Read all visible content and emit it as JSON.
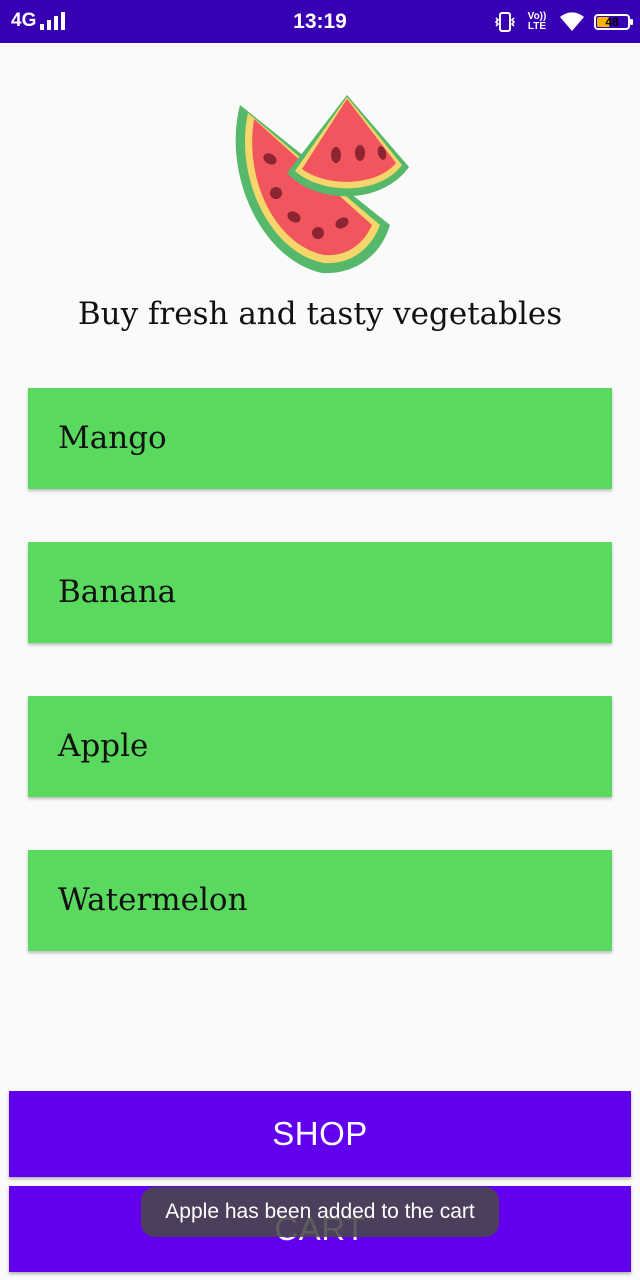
{
  "status_bar": {
    "network": "4G",
    "time": "13:19",
    "volte_label": "Vo)) LTE",
    "battery_level": "48",
    "battery_fraction": 0.48
  },
  "icons": {
    "logo": "watermelon-slices-icon",
    "signal": "signal-bars-icon",
    "vibrate": "vibrate-icon",
    "wifi": "wifi-icon",
    "battery": "battery-icon"
  },
  "colors": {
    "status_bar": "#3700b3",
    "item_background": "#5ad95f",
    "button_background": "#6200ee",
    "toast_background": "#484848"
  },
  "header": {
    "tagline": "Buy fresh and tasty vegetables"
  },
  "fruits": [
    {
      "label": "Mango"
    },
    {
      "label": "Banana"
    },
    {
      "label": "Apple"
    },
    {
      "label": "Watermelon"
    }
  ],
  "buttons": {
    "shop_label": "SHOP",
    "cart_label": "CART"
  },
  "toast": {
    "message": "Apple has been added to the cart"
  }
}
